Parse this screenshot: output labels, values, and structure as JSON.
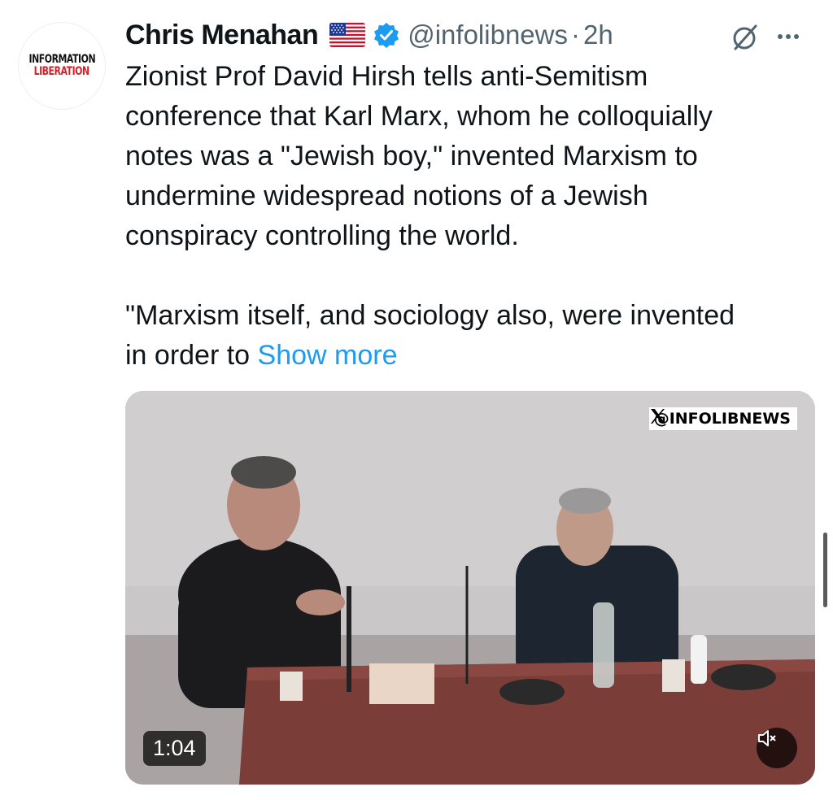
{
  "avatar": {
    "line1": "INFORMATION",
    "line2": "LIBERATION"
  },
  "author": {
    "name": "Chris Menahan",
    "flag_icon": "us-flag-icon",
    "verified_icon": "verified-badge-icon",
    "handle": "@infolibnews",
    "separator": "·",
    "time": "2h"
  },
  "actions": {
    "grok_icon": "grok-icon",
    "more_icon": "more-options-icon"
  },
  "tweet": {
    "paragraph1": "Zionist Prof David Hirsh tells anti-Semitism\nconference that Karl Marx, whom he colloquially\nnotes was a \"Jewish boy,\" invented Marxism to\nundermine widespread notions of a Jewish\nconspiracy controlling the world.",
    "paragraph2": "\"Marxism itself, and sociology also, were invented\nin order to ",
    "show_more": "Show more"
  },
  "video": {
    "watermark": "@INFOLIBNEWS",
    "duration": "1:04",
    "mute_icon": "speaker-muted-icon",
    "colors": {
      "wall": "#c9c7c8",
      "table": "#7a3d38",
      "shirt": "#1d2530"
    }
  },
  "colors": {
    "link": "#1d9bf0",
    "secondary_text": "#536471",
    "primary_text": "#0f1419",
    "verified": "#1d9bf0"
  }
}
